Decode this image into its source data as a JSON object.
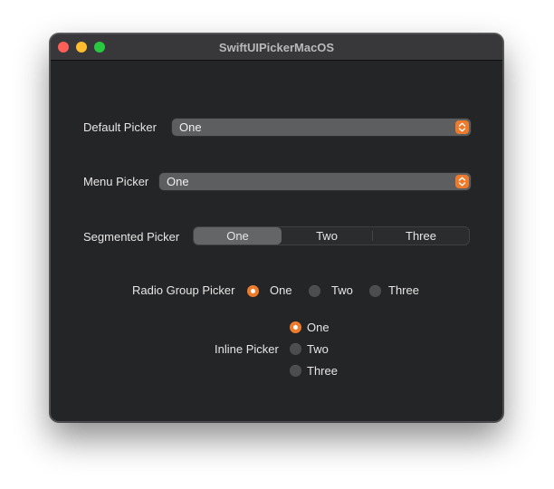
{
  "window": {
    "title": "SwiftUIPickerMacOS"
  },
  "pickers": {
    "default": {
      "label": "Default Picker",
      "value": "One"
    },
    "menu": {
      "label": "Menu Picker",
      "value": "One"
    },
    "segmented": {
      "label": "Segmented Picker",
      "options": [
        "One",
        "Two",
        "Three"
      ],
      "selected": "One"
    },
    "radio_group": {
      "label": "Radio Group Picker",
      "options": [
        "One",
        "Two",
        "Three"
      ],
      "selected": "One"
    },
    "inline": {
      "label": "Inline Picker",
      "options": [
        "One",
        "Two",
        "Three"
      ],
      "selected": "One"
    }
  },
  "colors": {
    "accent": "#ee7a2c",
    "window_bg": "#242527",
    "titlebar_bg": "#38383a"
  }
}
